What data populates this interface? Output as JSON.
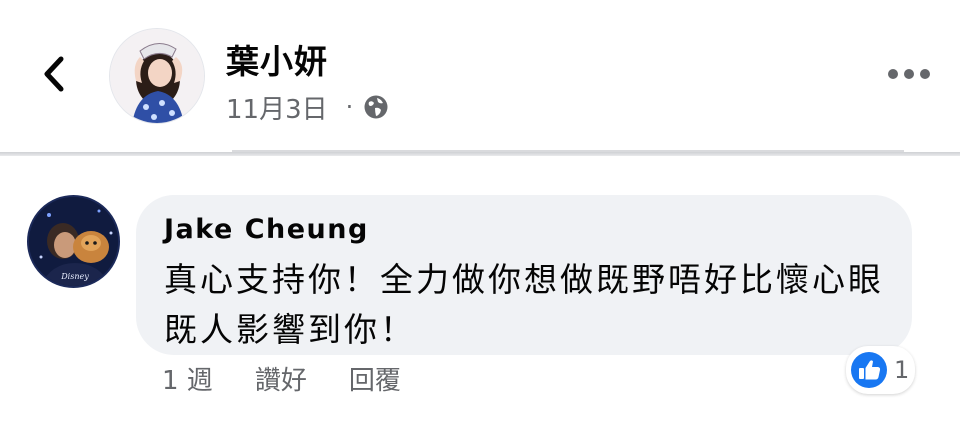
{
  "post": {
    "author_name": "葉小妍",
    "date": "11月3日",
    "separator": "·",
    "privacy_icon": "globe-icon",
    "back_icon": "chevron-left-icon",
    "more_icon": "more-horizontal-icon"
  },
  "comment": {
    "author_name": "Jake  Cheung",
    "text": "真心支持你！全力做你想做既野唔好比懷心眼既人影響到你！",
    "time": "1 週",
    "like_label": "讚好",
    "reply_label": "回覆",
    "reaction_icon": "like-icon",
    "reaction_count": "1"
  },
  "colors": {
    "secondary_text": "#65676b",
    "bubble_bg": "#f0f2f5",
    "like_blue": "#1877f2"
  }
}
